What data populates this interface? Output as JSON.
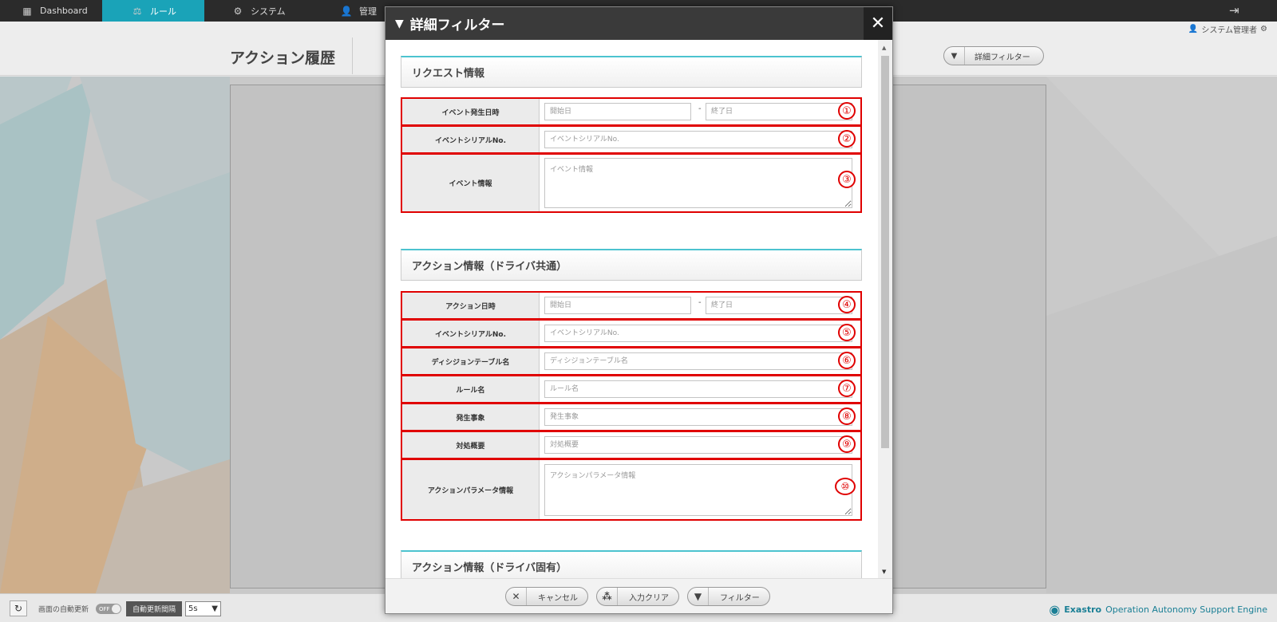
{
  "nav": {
    "tabs": [
      {
        "label": "Dashboard",
        "icon": "dashboard-icon"
      },
      {
        "label": "ルール",
        "icon": "scale-icon"
      },
      {
        "label": "システム",
        "icon": "gears-icon"
      },
      {
        "label": "管理",
        "icon": "user-admin-icon"
      }
    ],
    "active_tab": "ルール"
  },
  "user": {
    "name": "システム管理者"
  },
  "page": {
    "title": "アクション履歴",
    "filter_button": "詳細フィルター"
  },
  "footer": {
    "auto_refresh_label": "画面の自動更新",
    "toggle_state": "OFF",
    "interval_label": "自動更新間隔",
    "interval_value": "5s",
    "brand_name": "Exastro",
    "brand_tagline": "Operation Autonomy Support Engine"
  },
  "modal": {
    "title": "詳細フィルター",
    "sections": {
      "request": {
        "title": "リクエスト情報",
        "rows": {
          "event_date": {
            "label": "イベント発生日時",
            "start_placeholder": "開始日",
            "end_placeholder": "終了日",
            "separator": "-",
            "marker": "①"
          },
          "event_serial": {
            "label": "イベントシリアルNo.",
            "placeholder": "イベントシリアルNo.",
            "marker": "②"
          },
          "event_info": {
            "label": "イベント情報",
            "placeholder": "イベント情報",
            "marker": "③"
          }
        }
      },
      "action_common": {
        "title": "アクション情報（ドライバ共通）",
        "rows": {
          "action_date": {
            "label": "アクション日時",
            "start_placeholder": "開始日",
            "end_placeholder": "終了日",
            "separator": "-",
            "marker": "④"
          },
          "event_serial": {
            "label": "イベントシリアルNo.",
            "placeholder": "イベントシリアルNo.",
            "marker": "⑤"
          },
          "decision_table": {
            "label": "ディシジョンテーブル名",
            "placeholder": "ディシジョンテーブル名",
            "marker": "⑥"
          },
          "rule_name": {
            "label": "ルール名",
            "placeholder": "ルール名",
            "marker": "⑦"
          },
          "occurrence": {
            "label": "発生事象",
            "placeholder": "発生事象",
            "marker": "⑧"
          },
          "response_summary": {
            "label": "対処概要",
            "placeholder": "対処概要",
            "marker": "⑨"
          },
          "action_params": {
            "label": "アクションパラメータ情報",
            "placeholder": "アクションパラメータ情報",
            "marker": "⑩"
          }
        }
      },
      "action_specific": {
        "title": "アクション情報（ドライバ固有）"
      }
    },
    "buttons": {
      "cancel": "キャンセル",
      "clear": "入力クリア",
      "filter": "フィルター"
    }
  },
  "colors": {
    "accent": "#1aa3b8",
    "highlight": "#e00000",
    "header_bg": "#3a3a3a"
  }
}
